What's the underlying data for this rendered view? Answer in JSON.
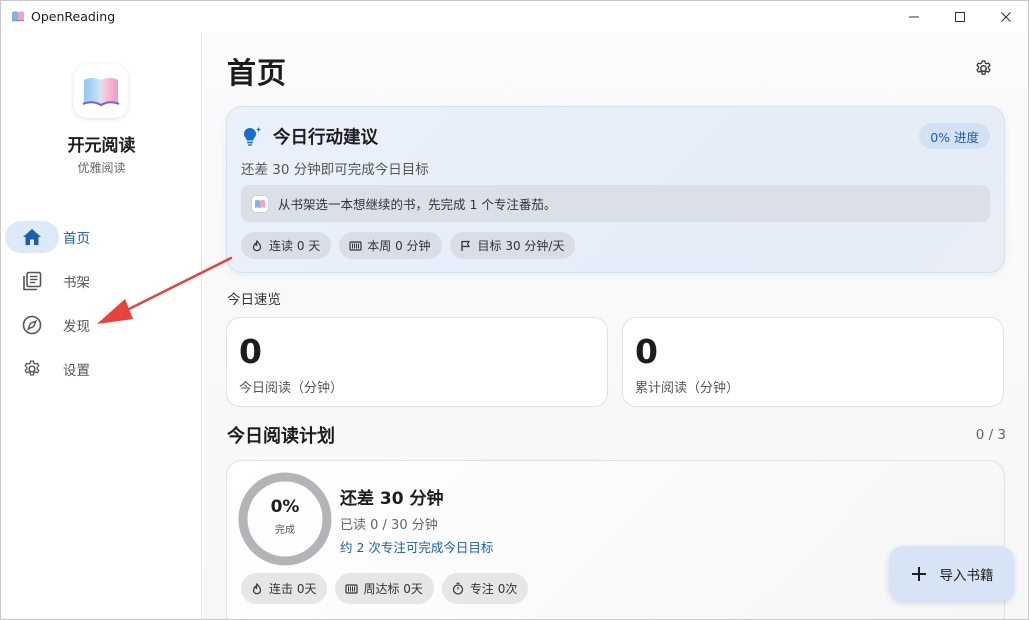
{
  "window": {
    "title": "OpenReading",
    "controls": [
      "minimize",
      "maximize",
      "close"
    ]
  },
  "sidebar": {
    "brand_name": "开元阅读",
    "brand_subtitle": "优雅阅读",
    "items": [
      {
        "label": "首页",
        "icon": "home-icon",
        "active": true
      },
      {
        "label": "书架",
        "icon": "library-icon",
        "active": false
      },
      {
        "label": "发现",
        "icon": "compass-icon",
        "active": false
      },
      {
        "label": "设置",
        "icon": "gear-icon",
        "active": false
      }
    ]
  },
  "main": {
    "page_title": "首页",
    "suggestion": {
      "title": "今日行动建议",
      "progress_pill": "0% 进度",
      "subtitle": "还差 30 分钟即可完成今日目标",
      "tip": "从书架选一本想继续的书，先完成 1 个专注番茄。",
      "chips": [
        "连读 0 天",
        "本周 0 分钟",
        "目标 30 分钟/天"
      ]
    },
    "overview_label": "今日速览",
    "stats": [
      {
        "value": "0",
        "label": "今日阅读（分钟）"
      },
      {
        "value": "0",
        "label": "累计阅读（分钟）"
      }
    ],
    "plan": {
      "title": "今日阅读计划",
      "count": "0 / 3",
      "progress_fraction": 0,
      "ring_percent": "0%",
      "ring_label": "完成",
      "remaining": "还差 30 分钟",
      "read": "已读 0 / 30 分钟",
      "hint": "约 2 次专注可完成今日目标",
      "chips": [
        "连击 0天",
        "周达标 0天",
        "专注 0次"
      ]
    },
    "fab_label": "导入书籍"
  },
  "colors": {
    "accent": "#1a5fa8",
    "annotation_arrow": "#e8423f"
  }
}
